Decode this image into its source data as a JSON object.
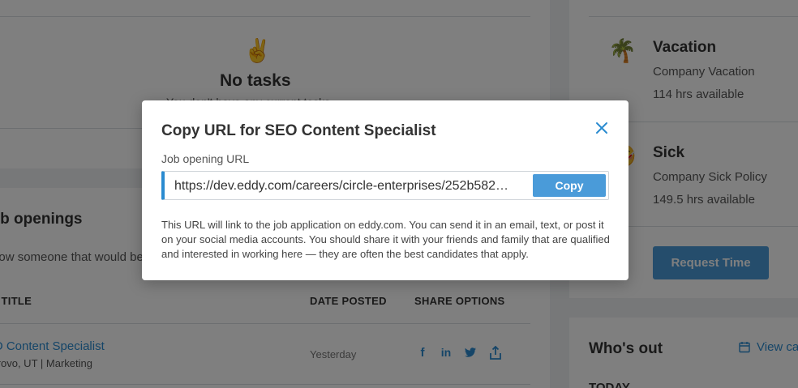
{
  "tasks": {
    "icon": "victory-hand-icon",
    "glyph": "✌️",
    "title": "No tasks",
    "subtitle": "You don't have any current tasks"
  },
  "job_openings": {
    "heading": "Job openings",
    "subtext": "Know someone that would be",
    "columns": {
      "title": "JOB TITLE",
      "date_posted": "DATE POSTED",
      "share_options": "SHARE OPTIONS"
    },
    "rows": [
      {
        "title": "SEO Content Specialist",
        "meta": "Provo, UT | Marketing",
        "date": "Yesterday"
      }
    ]
  },
  "time_off": {
    "items": [
      {
        "icon": "palm-tree-icon",
        "glyph": "🌴",
        "name": "Vacation",
        "policy": "Company Vacation",
        "available": "114 hrs available"
      },
      {
        "icon": "sick-face-icon",
        "glyph": "🤒",
        "name": "Sick",
        "policy": "Company Sick Policy",
        "available": "149.5 hrs available"
      }
    ],
    "request_button": "Request Time"
  },
  "whos_out": {
    "heading": "Who's out",
    "view_link": "View calendar",
    "today": "TODAY"
  },
  "modal": {
    "title": "Copy URL for SEO Content Specialist",
    "field_label": "Job opening URL",
    "url": "https://dev.eddy.com/careers/circle-enterprises/252b582d-…",
    "copy_button": "Copy",
    "description": "This URL will link to the job application on eddy.com. You can send it in an email, text, or post it on your social media accounts. You should share it with your friends and family that are qualified and interested in working here — they are often the best candidates that apply."
  },
  "colors": {
    "accent": "#2a8bd0",
    "button": "#4a9bd9",
    "overlay": "rgba(0,0,0,0.5)"
  }
}
